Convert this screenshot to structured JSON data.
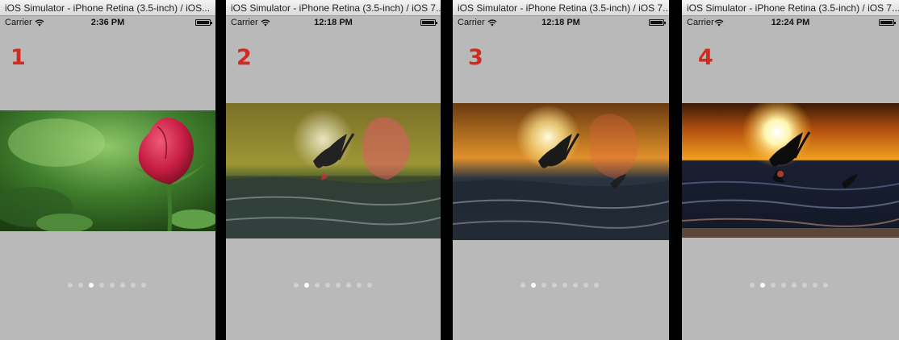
{
  "panels": [
    {
      "window_title": "iOS Simulator - iPhone Retina (3.5-inch) / iOS...",
      "carrier": "Carrier",
      "time": "2:36 PM",
      "step": "1",
      "image": "rose",
      "page_count": 8,
      "current_page": 2
    },
    {
      "window_title": "iOS Simulator - iPhone Retina (3.5-inch) / iOS 7...",
      "carrier": "Carrier",
      "time": "12:18 PM",
      "step": "2",
      "image": "sunset-rose-crossfade-heavy",
      "page_count": 8,
      "current_page": 1
    },
    {
      "window_title": "iOS Simulator - iPhone Retina (3.5-inch) / iOS 7...",
      "carrier": "Carrier",
      "time": "12:18 PM",
      "step": "3",
      "image": "sunset-rose-crossfade-light",
      "page_count": 8,
      "current_page": 1
    },
    {
      "window_title": "iOS Simulator - iPhone Retina (3.5-inch) / iOS 7...",
      "carrier": "Carrier",
      "time": "12:24 PM",
      "step": "4",
      "image": "sunset-pelican",
      "page_count": 8,
      "current_page": 1
    }
  ],
  "colors": {
    "step_number": "#d22a1e",
    "screen_background": "#b9b9b9"
  }
}
